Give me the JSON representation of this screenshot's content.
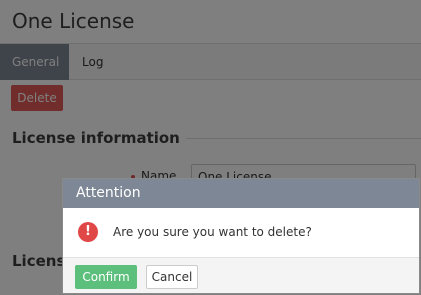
{
  "page": {
    "title": "One License"
  },
  "tabs": [
    {
      "label": "General",
      "active": true
    },
    {
      "label": "Log",
      "active": false
    }
  ],
  "actions": {
    "delete_label": "Delete"
  },
  "sections": [
    {
      "title": "License information"
    },
    {
      "title": "Licens"
    }
  ],
  "form": {
    "name_label": "Name",
    "name_value": "One License",
    "name_required": true
  },
  "dialog": {
    "title": "Attention",
    "message": "Are you sure you want to delete?",
    "icon": "exclamation-circle-icon",
    "confirm_label": "Confirm",
    "cancel_label": "Cancel"
  },
  "colors": {
    "header_gray": "#7e8795",
    "danger": "#e35a57",
    "confirm_green": "#5cbf7c",
    "alert_red": "#e04848"
  }
}
